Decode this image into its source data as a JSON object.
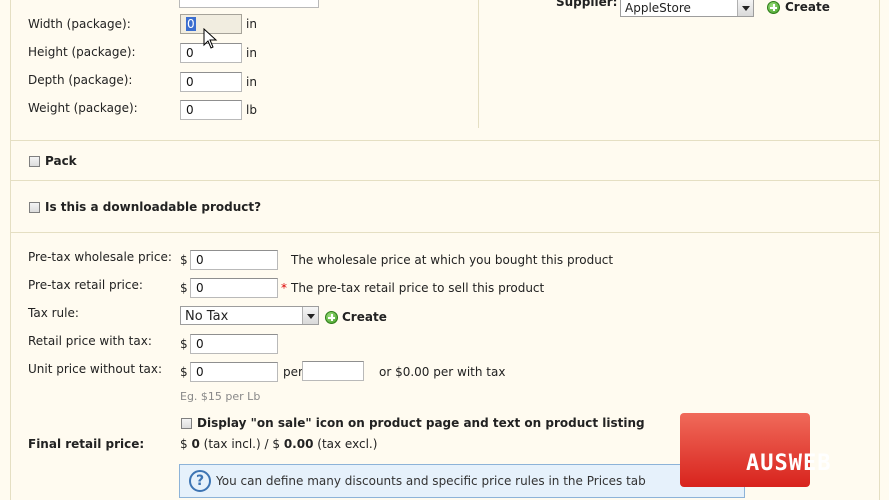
{
  "package": {
    "width_label": "Width (package):",
    "width_value": "0",
    "width_unit": "in",
    "height_label": "Height (package):",
    "height_value": "0",
    "height_unit": "in",
    "depth_label": "Depth (package):",
    "depth_value": "0",
    "depth_unit": "in",
    "weight_label": "Weight (package):",
    "weight_value": "0",
    "weight_unit": "lb"
  },
  "supplier": {
    "label": "Supplier:",
    "selected": "AppleStore",
    "create_label": "Create"
  },
  "pack": {
    "label": "Pack"
  },
  "downloadable": {
    "label": "Is this a downloadable product?"
  },
  "prices": {
    "currency": "$",
    "wholesale_label": "Pre-tax wholesale price:",
    "wholesale_value": "0",
    "wholesale_desc": "The wholesale price at which you bought this product",
    "retail_label": "Pre-tax retail price:",
    "retail_value": "0",
    "required_mark": "*",
    "retail_desc": "The pre-tax retail price to sell this product",
    "tax_rule_label": "Tax rule:",
    "tax_rule_selected": "No Tax",
    "tax_create_label": "Create",
    "retail_tax_label": "Retail price with tax:",
    "retail_tax_value": "0",
    "unit_label": "Unit price without tax:",
    "unit_value": "0",
    "unit_per": "per",
    "unit_per_value": "",
    "unit_with_tax": "or $0.00 per with tax",
    "unit_hint": "Eg. $15 per Lb",
    "on_sale_label": "Display \"on sale\" icon on product page and text on product listing",
    "final_label": "Final retail price:",
    "final_prefix": "$",
    "final_incl_value": "0",
    "final_incl_text": "(tax incl.) / $",
    "final_excl_value": "0.00",
    "final_excl_text": "(tax excl.)"
  },
  "info": {
    "text": "You can define many discounts and specific price rules in the Prices tab"
  },
  "watermark": {
    "text": "AUSWEB"
  },
  "colors": {
    "background": "#fffbf0",
    "border": "#e5dfc3",
    "logo": "#e0352a"
  }
}
